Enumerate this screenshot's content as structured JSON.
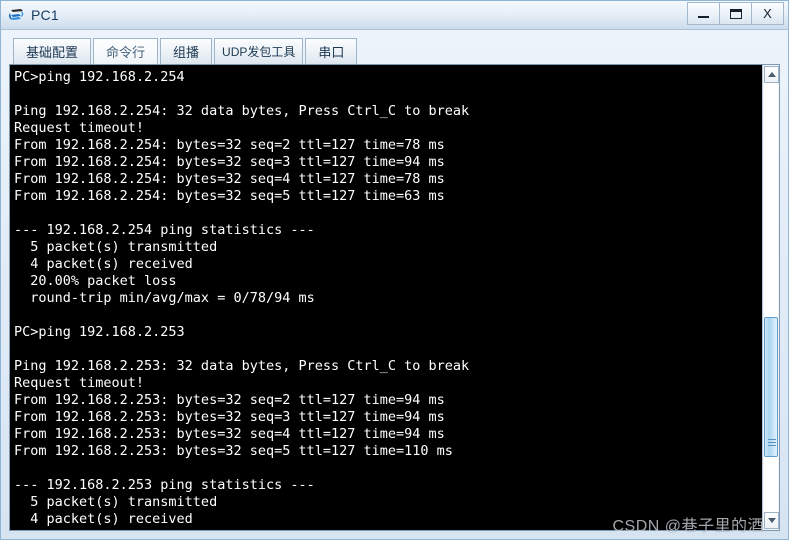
{
  "window": {
    "title": "PC1",
    "icon": "pc-device-icon",
    "buttons": {
      "minimize": "–",
      "maximize": "□",
      "close": "X"
    }
  },
  "tabs": [
    {
      "label": "基础配置",
      "name": "tab-basic-config",
      "active": false
    },
    {
      "label": "命令行",
      "name": "tab-command-line",
      "active": true
    },
    {
      "label": "组播",
      "name": "tab-multicast",
      "active": false
    },
    {
      "label": "UDP发包工具",
      "name": "tab-udp-tool",
      "active": false
    },
    {
      "label": "串口",
      "name": "tab-serial-port",
      "active": false
    }
  ],
  "terminal": {
    "lines": [
      "PC>ping 192.168.2.254",
      "",
      "Ping 192.168.2.254: 32 data bytes, Press Ctrl_C to break",
      "Request timeout!",
      "From 192.168.2.254: bytes=32 seq=2 ttl=127 time=78 ms",
      "From 192.168.2.254: bytes=32 seq=3 ttl=127 time=94 ms",
      "From 192.168.2.254: bytes=32 seq=4 ttl=127 time=78 ms",
      "From 192.168.2.254: bytes=32 seq=5 ttl=127 time=63 ms",
      "",
      "--- 192.168.2.254 ping statistics ---",
      "  5 packet(s) transmitted",
      "  4 packet(s) received",
      "  20.00% packet loss",
      "  round-trip min/avg/max = 0/78/94 ms",
      "",
      "PC>ping 192.168.2.253",
      "",
      "Ping 192.168.2.253: 32 data bytes, Press Ctrl_C to break",
      "Request timeout!",
      "From 192.168.2.253: bytes=32 seq=2 ttl=127 time=94 ms",
      "From 192.168.2.253: bytes=32 seq=3 ttl=127 time=94 ms",
      "From 192.168.2.253: bytes=32 seq=4 ttl=127 time=94 ms",
      "From 192.168.2.253: bytes=32 seq=5 ttl=127 time=110 ms",
      "",
      "--- 192.168.2.253 ping statistics ---",
      "  5 packet(s) transmitted",
      "  4 packet(s) received"
    ]
  },
  "scrollbar": {
    "up_arrow": "scroll-up-arrow",
    "down_arrow": "scroll-down-arrow"
  },
  "watermark": {
    "text": "CSDN @巷子里的酒"
  },
  "colors": {
    "terminal_bg": "#000000",
    "terminal_fg": "#ffffff",
    "titlebar_accent": "#1a3c63",
    "scroll_thumb": "#a9d6f2",
    "window_border": "#8fb4d4"
  }
}
